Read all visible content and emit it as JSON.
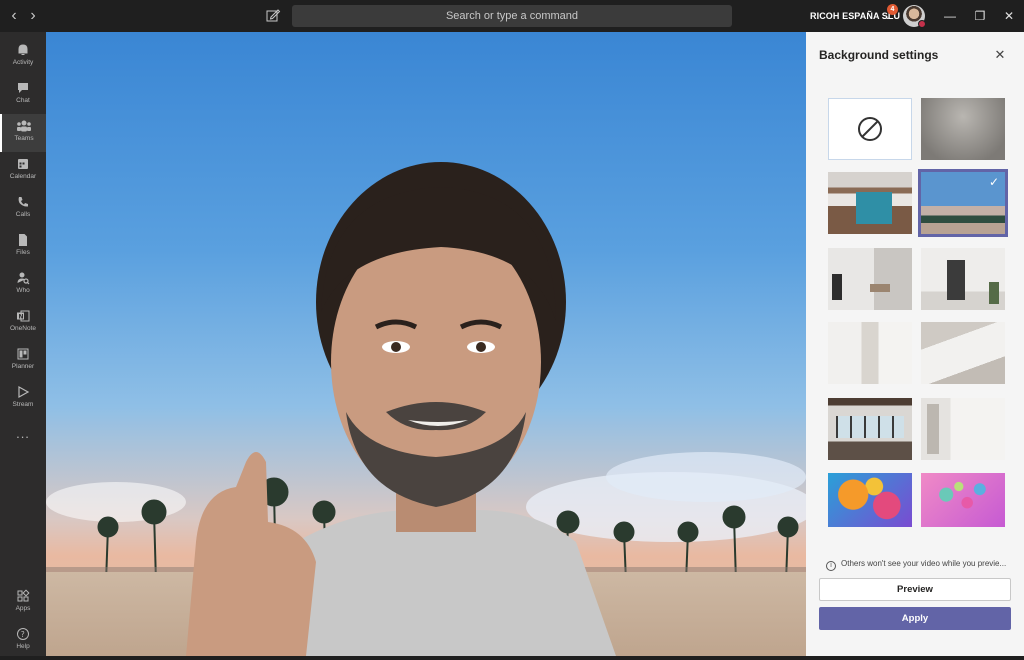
{
  "titlebar": {
    "search_placeholder": "Search or type a command",
    "org_name": "RICOH ESPAÑA SLU",
    "notification_count": "4",
    "back_icon": "chevron-left-icon",
    "forward_icon": "chevron-right-icon",
    "compose_icon": "compose-icon"
  },
  "rail": {
    "items": [
      {
        "label": "Activity",
        "icon": "bell-icon"
      },
      {
        "label": "Chat",
        "icon": "chat-icon"
      },
      {
        "label": "Teams",
        "icon": "teams-icon",
        "active": true
      },
      {
        "label": "Calendar",
        "icon": "calendar-icon"
      },
      {
        "label": "Calls",
        "icon": "phone-icon"
      },
      {
        "label": "Files",
        "icon": "file-icon"
      },
      {
        "label": "Who",
        "icon": "who-icon"
      },
      {
        "label": "OneNote",
        "icon": "onenote-icon"
      },
      {
        "label": "Planner",
        "icon": "planner-icon"
      },
      {
        "label": "Stream",
        "icon": "stream-icon"
      }
    ],
    "more": "...",
    "apps": {
      "label": "Apps",
      "icon": "apps-icon"
    },
    "help": {
      "label": "Help",
      "icon": "help-icon"
    }
  },
  "panel": {
    "title": "Background settings",
    "info_text": "Others won't see your video while you previe...",
    "preview_label": "Preview",
    "apply_label": "Apply"
  },
  "colors": {
    "accent": "#6264a7",
    "rail_bg": "#2d2c2c",
    "titlebar_bg": "#1f1f1f",
    "panel_bg": "#f5f5f5"
  }
}
